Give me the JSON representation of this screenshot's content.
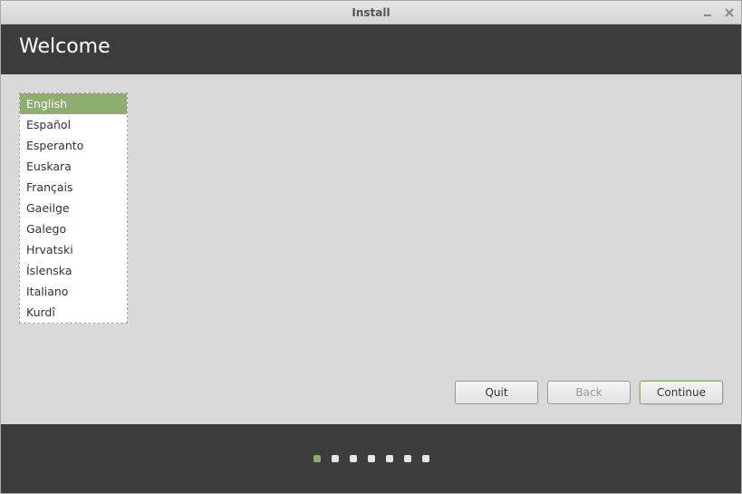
{
  "window": {
    "title": "Install"
  },
  "header": {
    "title": "Welcome"
  },
  "languages": {
    "items": [
      "English",
      "Español",
      "Esperanto",
      "Euskara",
      "Français",
      "Gaeilge",
      "Galego",
      "Hrvatski",
      "Íslenska",
      "Italiano",
      "Kurdî"
    ],
    "selected_index": 0
  },
  "buttons": {
    "quit": "Quit",
    "back": "Back",
    "continue": "Continue"
  },
  "progress": {
    "total": 7,
    "current": 0
  }
}
